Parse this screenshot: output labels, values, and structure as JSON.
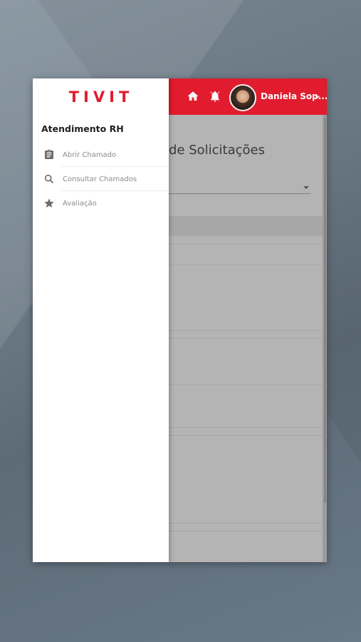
{
  "brand": {
    "logo_text": "TIVIT",
    "color": "#e01c2e"
  },
  "topbar": {
    "icons": [
      "home-icon",
      "bell-icon"
    ],
    "user_name": "Daniela Sop...",
    "chevron": "chevron-down-icon"
  },
  "main": {
    "page_heading": "de Solicitações"
  },
  "drawer": {
    "title": "Atendimento RH",
    "items": [
      {
        "label": "Abrir Chamado",
        "icon": "clipboard-icon"
      },
      {
        "label": "Consultar Chamados",
        "icon": "search-icon"
      },
      {
        "label": "Avaliação",
        "icon": "star-icon"
      }
    ]
  }
}
